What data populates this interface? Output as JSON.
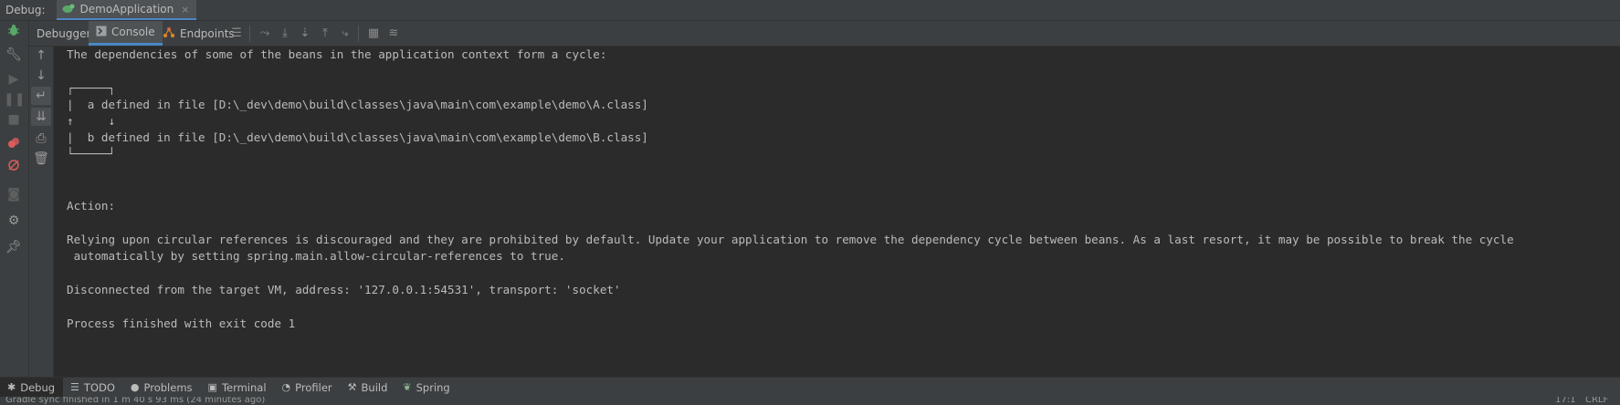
{
  "title_bar": {
    "label": "Debug:",
    "run_tab": "DemoApplication",
    "close_glyph": "×"
  },
  "toolbar": {
    "tabs": [
      {
        "label": "Debugger",
        "icon": ""
      },
      {
        "label": "Console",
        "icon": "console-icon"
      },
      {
        "label": "Endpoints",
        "icon": "endpoints-icon"
      }
    ]
  },
  "console": {
    "lines": [
      "The dependencies of some of the beans in the application context form a cycle:",
      "",
      "┌─────┐",
      "|  a defined in file [D:\\_dev\\demo\\build\\classes\\java\\main\\com\\example\\demo\\A.class]",
      "↑     ↓",
      "|  b defined in file [D:\\_dev\\demo\\build\\classes\\java\\main\\com\\example\\demo\\B.class]",
      "└─────┘",
      "",
      "",
      "Action:",
      "",
      "Relying upon circular references is discouraged and they are prohibited by default. Update your application to remove the dependency cycle between beans. As a last resort, it may be possible to break the cycle",
      " automatically by setting spring.main.allow-circular-references to true.",
      "",
      "Disconnected from the target VM, address: '127.0.0.1:54531', transport: 'socket'",
      "",
      "Process finished with exit code 1"
    ]
  },
  "bottom_bar": {
    "tabs": [
      {
        "label": "Debug",
        "icon": "bug-icon",
        "active": true
      },
      {
        "label": "TODO",
        "icon": "list-icon",
        "active": false
      },
      {
        "label": "Problems",
        "icon": "problems-icon",
        "active": false
      },
      {
        "label": "Terminal",
        "icon": "terminal-icon",
        "active": false
      },
      {
        "label": "Profiler",
        "icon": "profiler-icon",
        "active": false
      },
      {
        "label": "Build",
        "icon": "hammer-icon",
        "active": false
      },
      {
        "label": "Spring",
        "icon": "spring-leaf-icon",
        "active": false
      }
    ]
  },
  "status_bar": {
    "message": "Gradle sync finished in 1 m 40 s 93 ms (24 minutes ago)",
    "position": "17:1",
    "line_sep": "CRLF"
  },
  "colors": {
    "accent": "#4a88c7",
    "background": "#2b2b2b",
    "panel": "#3c3f41",
    "text": "#bbbbbb",
    "bug_green": "#59a869",
    "breakpoint_red": "#db5c5c"
  }
}
